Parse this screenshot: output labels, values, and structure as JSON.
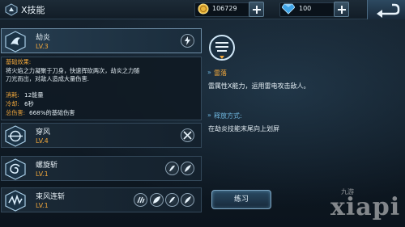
{
  "header": {
    "title": "X技能",
    "gold": "106729",
    "gems": "100",
    "gold_icon": "coin-icon",
    "gem_icon": "diamond-icon"
  },
  "skills": [
    {
      "name": "劫炎",
      "level": "LV.3"
    },
    {
      "name": "穿风",
      "level": "LV.4"
    },
    {
      "name": "螺旋斩",
      "level": "LV.1"
    },
    {
      "name": "束风连斩",
      "level": "LV.1"
    }
  ],
  "detail": {
    "effect_label": "基础效果:",
    "effect_line1": "将火焰之力凝聚于刀身，快速挥砍两次，劫炎之力随",
    "effect_line2": "刀光而出，对敌人造成大量伤害.",
    "cost_label": "消耗:",
    "cost_value": "12能量",
    "cooldown_label": "冷却:",
    "cooldown_value": "6秒",
    "damage_label": "总伤害:",
    "damage_value": "668%的基础伤害"
  },
  "right": {
    "element_name": "雷落",
    "element_desc": "雷属性X能力，运用雷电攻击敌人。",
    "release_label": "释放方式:",
    "release_desc": "在劫炎技能末尾向上划屏",
    "practice_label": "练习"
  },
  "watermark": {
    "small": "九游",
    "big": "xiapi"
  },
  "colors": {
    "accent_orange": "#f1a73b",
    "accent_blue": "#6fb6de",
    "panel_border": "#33485a"
  }
}
